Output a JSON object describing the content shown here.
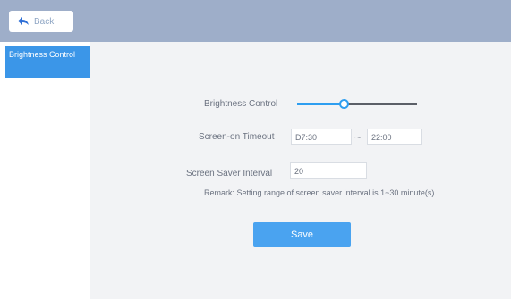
{
  "header": {
    "back_label": "Back"
  },
  "sidebar": {
    "items": [
      {
        "label": "Brightness Control",
        "active": true
      }
    ]
  },
  "form": {
    "brightness_label": "Brightness Control",
    "brightness_level_fraction": 0.38,
    "screen_on_label": "Screen-on Timeout",
    "screen_on_start": "D7:30",
    "screen_on_separator": "~",
    "screen_on_end": "22:00",
    "screen_saver_label": "Screen Saver Interval",
    "screen_saver_value": "20",
    "remark": "Remark: Setting range of screen saver interval is 1~30 minute(s).",
    "save_label": "Save"
  },
  "colors": {
    "topbar": "#9eaec9",
    "accent": "#3b96e8",
    "save_button": "#4aa3f0"
  },
  "icons": {
    "back": "back-arrow-icon"
  }
}
